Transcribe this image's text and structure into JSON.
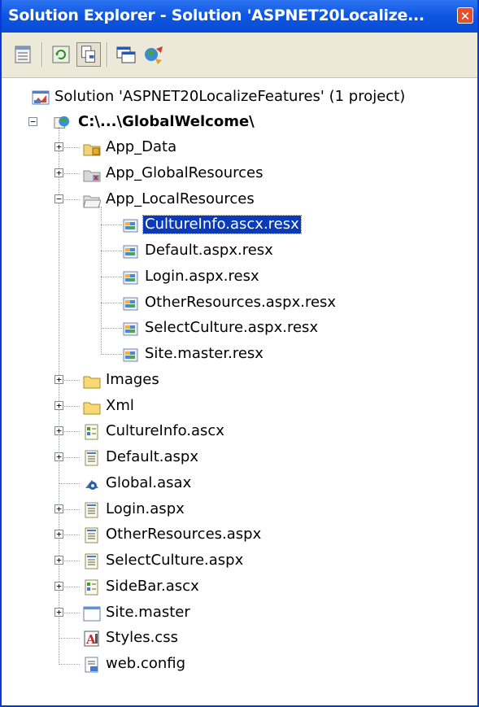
{
  "window": {
    "title": "Solution Explorer - Solution 'ASPNET20Localize...",
    "close_glyph": "✕"
  },
  "toolbar": {
    "buttons": [
      "properties-icon",
      "refresh-icon",
      "show-all-files-icon",
      "view-designer-icon",
      "copy-website-icon"
    ]
  },
  "tree": {
    "solution": "Solution 'ASPNET20LocalizeFeatures' (1 project)",
    "project": "C:\\...\\GlobalWelcome\\",
    "items": [
      {
        "label": "App_Data",
        "icon": "app-data-folder-icon",
        "expander": "+"
      },
      {
        "label": "App_GlobalResources",
        "icon": "global-resources-folder-icon",
        "expander": "+"
      },
      {
        "label": "App_LocalResources",
        "icon": "open-folder-icon",
        "expander": "−"
      },
      {
        "label": "CultureInfo.ascx.resx",
        "icon": "resx-icon",
        "selected": true
      },
      {
        "label": "Default.aspx.resx",
        "icon": "resx-icon"
      },
      {
        "label": "Login.aspx.resx",
        "icon": "resx-icon"
      },
      {
        "label": "OtherResources.aspx.resx",
        "icon": "resx-icon"
      },
      {
        "label": "SelectCulture.aspx.resx",
        "icon": "resx-icon"
      },
      {
        "label": "Site.master.resx",
        "icon": "resx-icon"
      },
      {
        "label": "Images",
        "icon": "folder-icon",
        "expander": "+"
      },
      {
        "label": "Xml",
        "icon": "folder-icon",
        "expander": "+"
      },
      {
        "label": "CultureInfo.ascx",
        "icon": "user-control-icon",
        "expander": "+"
      },
      {
        "label": "Default.aspx",
        "icon": "web-form-icon",
        "expander": "+"
      },
      {
        "label": "Global.asax",
        "icon": "global-asax-icon"
      },
      {
        "label": "Login.aspx",
        "icon": "web-form-icon",
        "expander": "+"
      },
      {
        "label": "OtherResources.aspx",
        "icon": "web-form-icon",
        "expander": "+"
      },
      {
        "label": "SelectCulture.aspx",
        "icon": "web-form-icon",
        "expander": "+"
      },
      {
        "label": "SideBar.ascx",
        "icon": "user-control-icon",
        "expander": "+"
      },
      {
        "label": "Site.master",
        "icon": "master-page-icon",
        "expander": "+"
      },
      {
        "label": "Styles.css",
        "icon": "stylesheet-icon"
      },
      {
        "label": "web.config",
        "icon": "config-icon"
      }
    ]
  }
}
